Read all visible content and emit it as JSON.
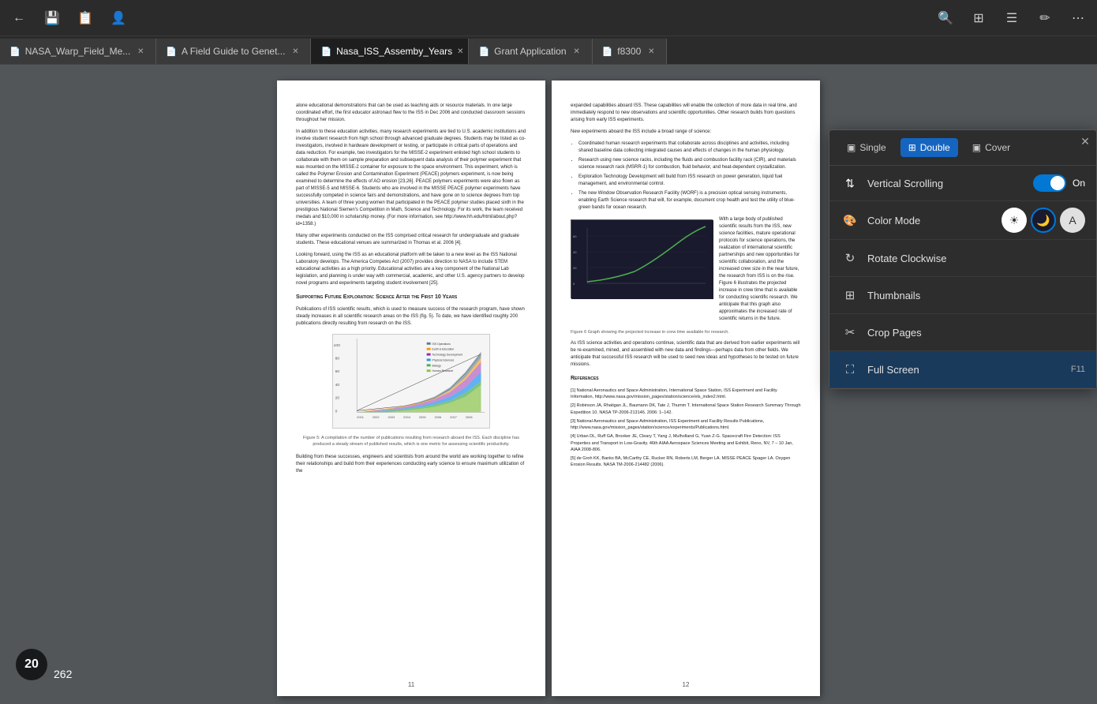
{
  "toolbar": {
    "back_icon": "←",
    "save_icon": "💾",
    "save_all_icon": "📋",
    "add_user_icon": "👤",
    "search_icon": "🔍",
    "grid_icon": "⊞",
    "list_icon": "☰",
    "pen_icon": "✏",
    "more_icon": "⋯"
  },
  "tabs": [
    {
      "id": "tab1",
      "label": "NASA_Warp_Field_Me...",
      "active": false,
      "icon": "📄"
    },
    {
      "id": "tab2",
      "label": "A Field Guide to Genet...",
      "active": false,
      "icon": "📄"
    },
    {
      "id": "tab3",
      "label": "Nasa_ISS_Assemby_Years",
      "active": true,
      "icon": "📄"
    },
    {
      "id": "tab4",
      "label": "Grant Application",
      "active": false,
      "icon": "📄"
    },
    {
      "id": "tab5",
      "label": "f8300",
      "active": false,
      "icon": "📄"
    }
  ],
  "pdf": {
    "current_page": 20,
    "total_pages": 262,
    "page_left_num": "11",
    "page_right_num": "12",
    "left_content": {
      "paragraphs": [
        "alone educational demonstrations that can be used as teaching aids or resource materials. In one large coordinated effort, the first educator astronaut flew to the ISS in Dec 2006 and conducted classroom sessions throughout her mission.",
        "In addition to these education activities, many research experiments are tied to U.S. academic institutions and involve student research from high school through advanced graduate degrees. Students may be listed as co-investigators, involved in hardware development or testing, or participate in critical parts of operations and data reduction. For example, two investigators for the MISSE-2 experiment enlisted high school students to collaborate with them on sample preparation and subsequent data analysis of their polymer experiment that was mounted on the MISSE-2 container for exposure to the space environment. This experiment, which is called the Polymer Erosion and Contamination Experiment (PEACE) polymers experiment, is now being examined to determine the effects of AO erosion [23,26]. PEACE polymers experiments were also flown as part of MISSE-5 and MISSE-6. Students who are involved in the MISSE PEACE polymer experiments have successfully competed in science fairs and demonstrations, and have gone on to science degrees from top universities. A team of three young women that participated in the PEACE polymer studies placed sixth in the prestigious National Siemen's Competition in Math, Science and Technology. For its work, the team received medals and $10,000 in scholarship money. (For more information, see http://www.hh.edu/html/about.php?id=1358.)",
        "Many other experiments conducted on the ISS comprised critical research for undergraduate and graduate students. These educational venues are summarized in Thomas et al. 2006 [4].",
        "Looking forward, using the ISS as an educational platform will be taken to a new level as the ISS National Laboratory develops. The America Competes Act (2007) provides direction to NASA to include STEM educational activities as a high priority. Educational activities are a key component of the National Lab legislation, and planning is under way with commercial, academic, and other U.S. agency partners to develop novel programs and experiments targeting student involvement [25]."
      ],
      "section_title": "Supporting Future Exploration: Science After the First 10 Years",
      "section_body": "Publications of ISS scientific results, which is used to measure success of the research program, have shown steady increases in all scientific research areas on the ISS (fig. 5). To date, we have identified roughly 200 publications directly resulting from research on the ISS.",
      "chart_caption": "Figure 5: A compilation of the number of publications resulting from research aboard the ISS. Each discipline has produced a steady stream of published results, which is one metric for assessing scientific productivity.",
      "building_text": "Building from these successes, engineers and scientists from around the world are working together to refine their relationships and build from their experiences conducting early science to ensure maximum utilization of the"
    },
    "right_content": {
      "expanded": "expanded capabilities aboard ISS. These capabilities will enable the collection of more data in real time, and immediately respond to new observations and scientific opportunities. Other research builds from questions arising from early ISS experiments.",
      "new_experiments": "New experiments aboard the ISS include a broad range of science:",
      "bullets": [
        "Coordinated human research experiments that collaborate across disciplines and activities, including shared baseline data collecting integrated causes and effects of changes in the human physiology.",
        "Research using new science racks, including the fluids and combustion facility rack (CIR), and materials science research rack (MSRR-1) for combustion, fluid behavior, and heat-dependent crystallization.",
        "Exploration Technology Development will build from ISS research on power generation, liquid fuel management, and environmental control.",
        "The new Window Observation Research Facility (WORF) is a precision optical sensing instruments, enabling Earth Science research that will, for example, document crop health and test the utility of blue-green bands for ocean research."
      ],
      "graph_text": "With a large body of published scientific results from the ISS, new science facilities, mature operational protocols for science operations, the realization of international scientific partnerships and new opportunities for scientific collaboration, and the increased crew size in the near future, the research from ISS is on the rise. Figure 6 illustrates the projected increase in crew time that is available for conducting scientific research. We anticipate that this graph also approximates the increased rate of scientific returns in the future.",
      "graph_caption": "Figure 6 Graph showing the projected increase in crew time available for research.",
      "further_text": "As ISS science activities and operations continue, scientific data that are derived from earlier experiments will be re-examined, mined, and assembled with new data and findings—perhaps data from other fields. We anticipate that successful ISS research will be used to seed new ideas and hypotheses to be tested on future missions.",
      "references_title": "References",
      "references": [
        "[1] National Aeronautics and Space Administration, International Space Station, ISS Experiment and Facility Information, http://www.nasa.gov/mission_pages/station/science/els_index2.html.",
        "[2] Robinson JA, Rhatigan JL, Baumann DK, Tate J, Thumm T. International Space Station Research Summary Through Expedition 10. NASA TP-2006-213146. 2006: 1–142.",
        "[3] National Aeronautics and Space Administration, ISS Experiment and Facility Results Publications, http://www.nasa.gov/mission_pages/station/science/experiments/Publications.html.",
        "[4] Urban DL, Ruff GA, Brooker JE, Cleary T, Yang J, Mulholland G, Yuan Z-G. Spacecraft Fire Detection: ISS Properties and Transport in Low-Gravity. 46th AIAA Aerospace Sciences Meeting and Exhibit, Reno, NV, 7 – 10 Jan, AIAA 2008-806.",
        "[5] de Groh KK, Banks BA, McCarthy CE, Rucker RN, Roberts LM, Berger LA. MISSE PEACE Spager LA. Oxygen Erosion Results. NASA TM-2006-214482 (2006)."
      ]
    }
  },
  "dropdown": {
    "close_icon": "✕",
    "view_modes": [
      {
        "id": "single",
        "label": "Single",
        "icon": "▣",
        "active": false
      },
      {
        "id": "double",
        "label": "Double",
        "icon": "⊞",
        "active": true
      },
      {
        "id": "cover",
        "label": "Cover",
        "icon": "▣",
        "active": false
      }
    ],
    "vertical_scrolling": {
      "label": "Vertical Scrolling",
      "icon": "⇅",
      "enabled": true,
      "toggle_label": "On"
    },
    "color_mode": {
      "label": "Color Mode",
      "icon": "🎨",
      "modes": [
        {
          "id": "light",
          "symbol": "☀",
          "active": false
        },
        {
          "id": "dark",
          "symbol": "🌙",
          "active": true
        },
        {
          "id": "auto",
          "symbol": "A",
          "active": false
        }
      ]
    },
    "items": [
      {
        "id": "rotate",
        "label": "Rotate Clockwise",
        "icon": "↻",
        "shortcut": ""
      },
      {
        "id": "thumbnails",
        "label": "Thumbnails",
        "icon": "⊞",
        "shortcut": ""
      },
      {
        "id": "crop",
        "label": "Crop Pages",
        "icon": "✂",
        "shortcut": ""
      },
      {
        "id": "fullscreen",
        "label": "Full Screen",
        "icon": "⛶",
        "shortcut": "F11",
        "highlighted": true
      }
    ]
  }
}
